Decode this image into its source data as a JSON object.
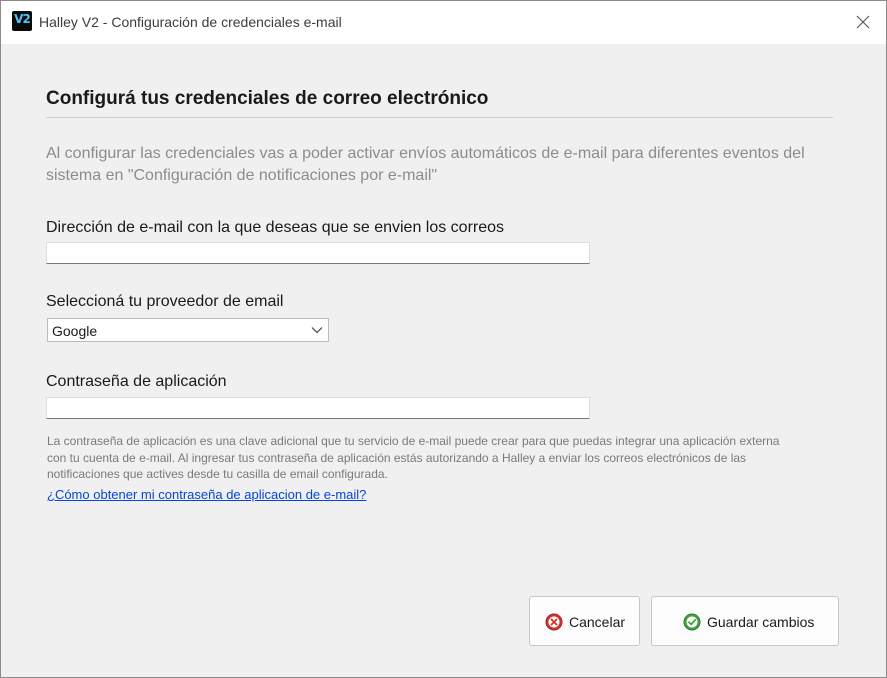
{
  "window": {
    "logo_text": "V2",
    "title": "Halley V2 - Configuración de credenciales e-mail"
  },
  "main": {
    "heading": "Configurá tus credenciales de correo electrónico",
    "intro": "Al configurar las credenciales vas a poder activar envíos automáticos de e-mail para diferentes eventos del sistema en \"Configuración de notificaciones por e-mail\""
  },
  "form": {
    "email_label": "Dirección de e-mail con la que deseas que se envien los correos",
    "email_value": "",
    "provider_label": "Seleccioná tu proveedor de email",
    "provider_value": "Google",
    "password_label": "Contraseña de aplicación",
    "password_value": "",
    "help_text": "La contraseña de aplicación es una clave adicional que tu servicio de e-mail puede crear para que puedas integrar una aplicación externa con tu cuenta de e-mail. Al ingresar tus contraseña de aplicación estás autorizando a Halley a enviar los correos electrónicos de las notificaciones que actives desde tu casilla de email configurada.",
    "help_link": "¿Cómo obtener mi contraseña de aplicacion de e-mail?"
  },
  "buttons": {
    "cancel_label": "Cancelar",
    "save_label": "Guardar cambios"
  },
  "icons": {
    "logo": "v2-logo-icon",
    "close": "close-icon",
    "chevron": "chevron-down-icon",
    "cancel": "cancel-circle-icon",
    "save": "check-circle-icon"
  },
  "colors": {
    "link": "#0645d8",
    "cancel_icon": "#d0342c",
    "save_icon": "#3fa33f",
    "logo_text": "#4fc3f7"
  }
}
